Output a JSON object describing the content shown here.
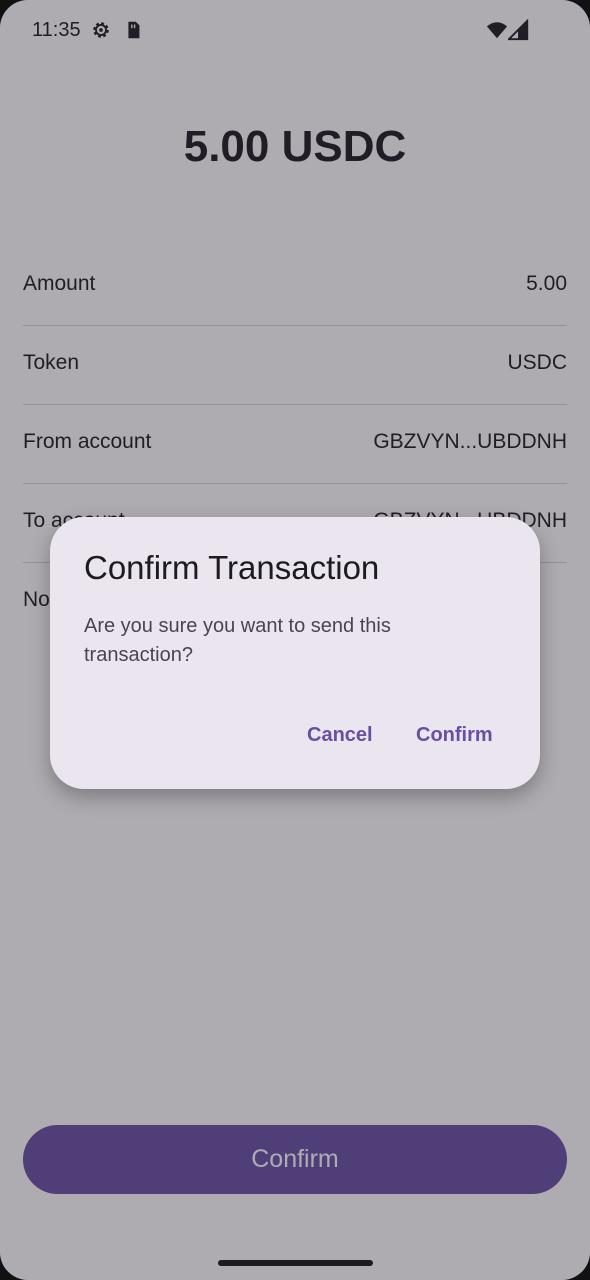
{
  "status_bar": {
    "time": "11:35",
    "icons": [
      "settings-gear-icon",
      "sim-card-icon",
      "wifi-icon",
      "signal-icon"
    ]
  },
  "transaction": {
    "title": "5.00 USDC",
    "rows": [
      {
        "label": "Amount",
        "value": "5.00"
      },
      {
        "label": "Token",
        "value": "USDC"
      },
      {
        "label": "From account",
        "value": "GBZVYN...UBDDNH"
      },
      {
        "label": "To account",
        "value": "GBZVYN...UBDDNH"
      },
      {
        "label": "Note",
        "value": ""
      }
    ],
    "confirm_button": "Confirm"
  },
  "dialog": {
    "title": "Confirm Transaction",
    "message": "Are you sure you want to send this transaction?",
    "cancel": "Cancel",
    "confirm": "Confirm"
  },
  "colors": {
    "accent": "#6750a4",
    "dialog_bg": "#ebe5f0",
    "scrim": "rgba(42,34,50,0.38)"
  }
}
